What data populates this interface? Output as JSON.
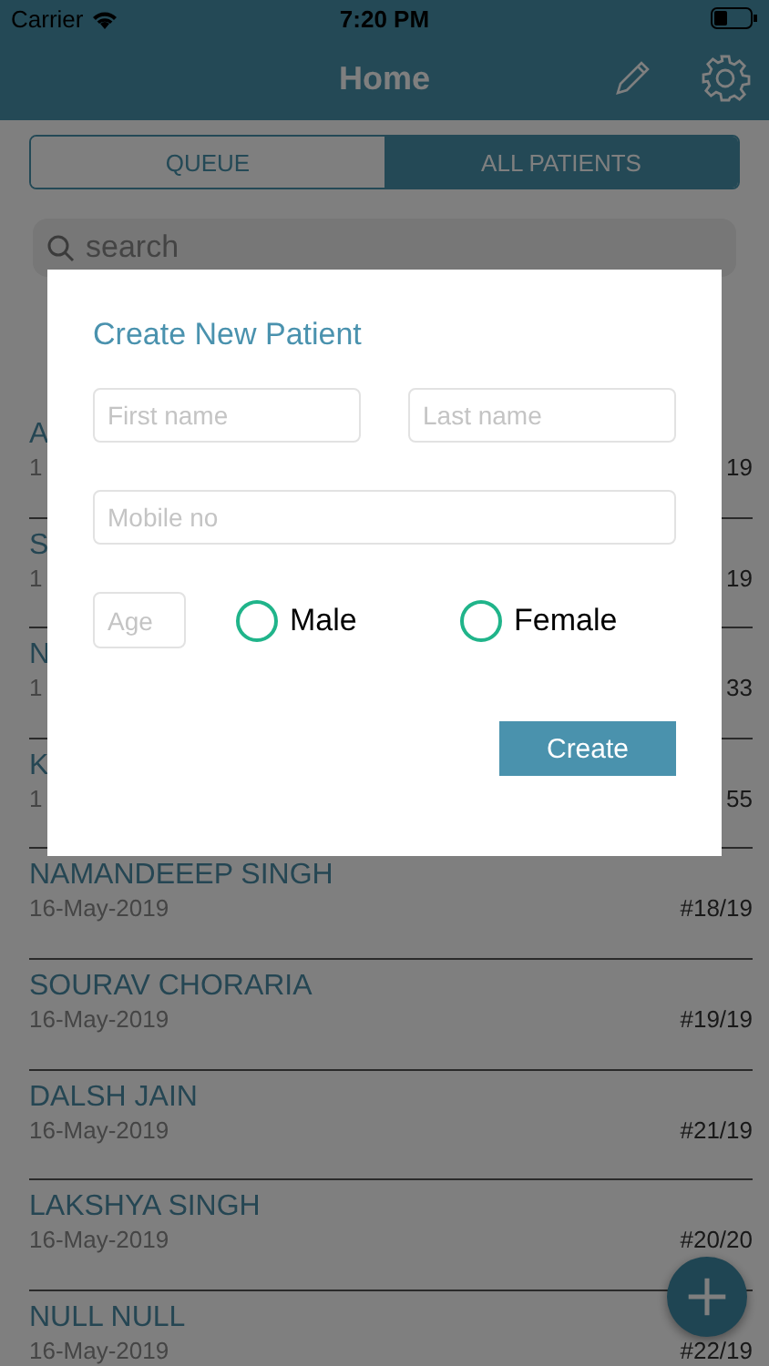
{
  "status_bar": {
    "carrier": "Carrier",
    "time": "7:20 PM"
  },
  "header": {
    "title": "Home"
  },
  "tabs": [
    {
      "label": "QUEUE",
      "selected": false
    },
    {
      "label": "ALL PATIENTS",
      "selected": true
    }
  ],
  "search": {
    "placeholder": "search"
  },
  "patients": [
    {
      "name": "A",
      "date": "1",
      "number": "19"
    },
    {
      "name": "S",
      "date": "1",
      "number": "19"
    },
    {
      "name": "N",
      "date": "1",
      "number": "33"
    },
    {
      "name": "K",
      "date": "1",
      "number": "55"
    },
    {
      "name": "NAMANDEEEP SINGH",
      "date": "16-May-2019",
      "number": "#18/19"
    },
    {
      "name": "SOURAV CHORARIA",
      "date": "16-May-2019",
      "number": "#19/19"
    },
    {
      "name": "DALSH JAIN",
      "date": "16-May-2019",
      "number": "#21/19"
    },
    {
      "name": "LAKSHYA SINGH",
      "date": "16-May-2019",
      "number": "#20/20"
    },
    {
      "name": "NULL NULL",
      "date": "16-May-2019",
      "number": "#22/19"
    }
  ],
  "dialog": {
    "title": "Create New Patient",
    "first_name": {
      "placeholder": "First name"
    },
    "last_name": {
      "placeholder": "Last name"
    },
    "mobile": {
      "placeholder": "Mobile no"
    },
    "age": {
      "placeholder": "Age"
    },
    "gender": [
      {
        "label": "Male",
        "selected": false
      },
      {
        "label": "Female",
        "selected": false
      }
    ],
    "button": "Create"
  }
}
